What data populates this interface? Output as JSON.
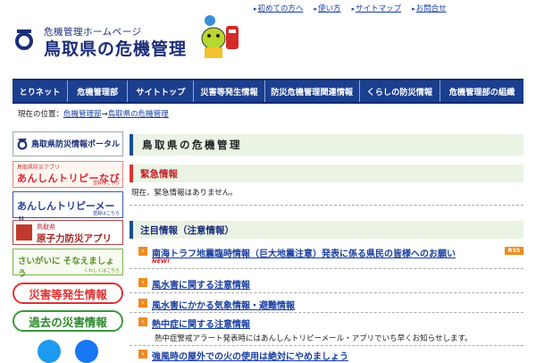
{
  "header": {
    "logo_kana": "危機管理ホームページ",
    "logo_title": "鳥取県の危機管理",
    "top_links": [
      "初めての方へ",
      "使い方",
      "サイトマップ",
      "お問合せ"
    ]
  },
  "nav": [
    "とりネット",
    "危機管理部",
    "サイトトップ",
    "災害等発生情報",
    "防災危機管理関連情報",
    "くらしの防災情報",
    "危機管理部の組織"
  ],
  "breadcrumb": {
    "prefix": "現在の位置：",
    "link1": "危機管理部",
    "arrow": "→",
    "link2": "鳥取県の危機管理"
  },
  "sidebar": {
    "portal": {
      "text": "鳥取県防災情報ポータル"
    },
    "navi": {
      "small": "鳥取県防災アプリ",
      "text": "あんしんトリピーなび",
      "reg": "登録はこちら"
    },
    "mail": {
      "text": "あんしんトリピーメール",
      "reg": "登録はこちら"
    },
    "nuclear": {
      "small": "鳥取県",
      "text": "原子力防災アプリ"
    },
    "sonae": {
      "text": "さいがいに そなえましょう",
      "reg": "くわしくはこちら"
    },
    "disaster_btn": "災害等発生情報",
    "past_btn": "過去の災害情報"
  },
  "main": {
    "title": "鳥取県の危機管理",
    "emergency_heading": "緊急情報",
    "emergency_text": "現在、緊急情報はありません。",
    "focus_heading": "注目情報（注意情報）",
    "rss": "RSS",
    "new_badge": "NEW!",
    "items": [
      "南海トラフ地震臨時情報（巨大地震注意）発表に係る県民の皆様へのお願い",
      "風水害に関する注意情報",
      "風水害にかかる気象情報・避難情報",
      "熱中症に関する注意情報",
      "強風時の屋外での火の使用は絶対にやめましょう"
    ],
    "heat_note": "熱中症警戒アラート発表時にはあんしんトリピーメール・アプリでいち早くお知らせします。"
  },
  "colors": {
    "nav": "#1b3e8f",
    "accent_orange": "#f08a1e",
    "emergency": "#c0262d"
  }
}
